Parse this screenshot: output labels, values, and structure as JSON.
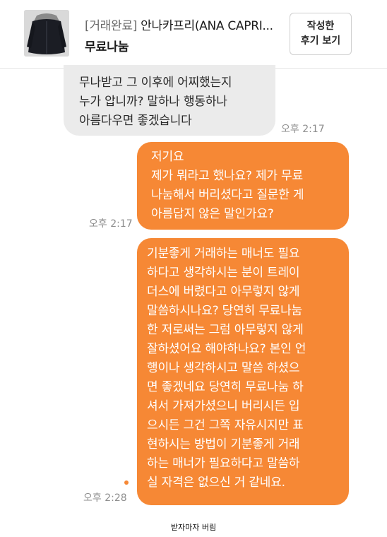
{
  "header": {
    "status": "[거래완료]",
    "product_name": "안나카프리(ANA CAPRI...",
    "subtitle": "무료나눔",
    "review_button_line1": "작성한",
    "review_button_line2": "후기 보기"
  },
  "messages": [
    {
      "direction": "incoming",
      "lines": [
        "무나받고 그 이후에 어찌했는지",
        "누가 압니까?  말하나 행동하나",
        "아름다우면 좋겠습니다"
      ],
      "time": "오후 2:17"
    },
    {
      "direction": "outgoing",
      "lines": [
        "저기요",
        "제가 뭐라고 했나요? 제가 무료",
        "나눔해서 버리셨다고 질문한 게",
        "아름답지 않은 말인가요?"
      ],
      "time": "오후 2:17"
    },
    {
      "direction": "outgoing",
      "lines": [
        "기분좋게 거래하는 매너도 필요",
        "하다고 생각하시는 분이 트레이",
        "더스에 버렸다고 아무렇지 않게",
        "말씀하시나요? 당연히 무료나눔",
        "한 저로써는 그럼 아무렇지 않게",
        "잘하셨어요 해야하나요? 본인 언",
        "행이나 생각하시고 말씀 하셨으",
        "면 좋겠네요 당연히 무료나눔 하",
        "셔서 가져가셨으니 버리시든 입",
        "으시든 그건 그쪽 자유시지만 표",
        "현하시는 방법이 기분좋게 거래",
        "하는 매너가 필요하다고 말씀하",
        "실 자격은 없으신 거 같네요."
      ],
      "time": "오후 2:28"
    }
  ],
  "caption": "받자마자 버림",
  "colors": {
    "outgoing_bubble": "#f68835",
    "incoming_bubble": "#ebebeb",
    "timestamp": "#8e8e8e"
  }
}
